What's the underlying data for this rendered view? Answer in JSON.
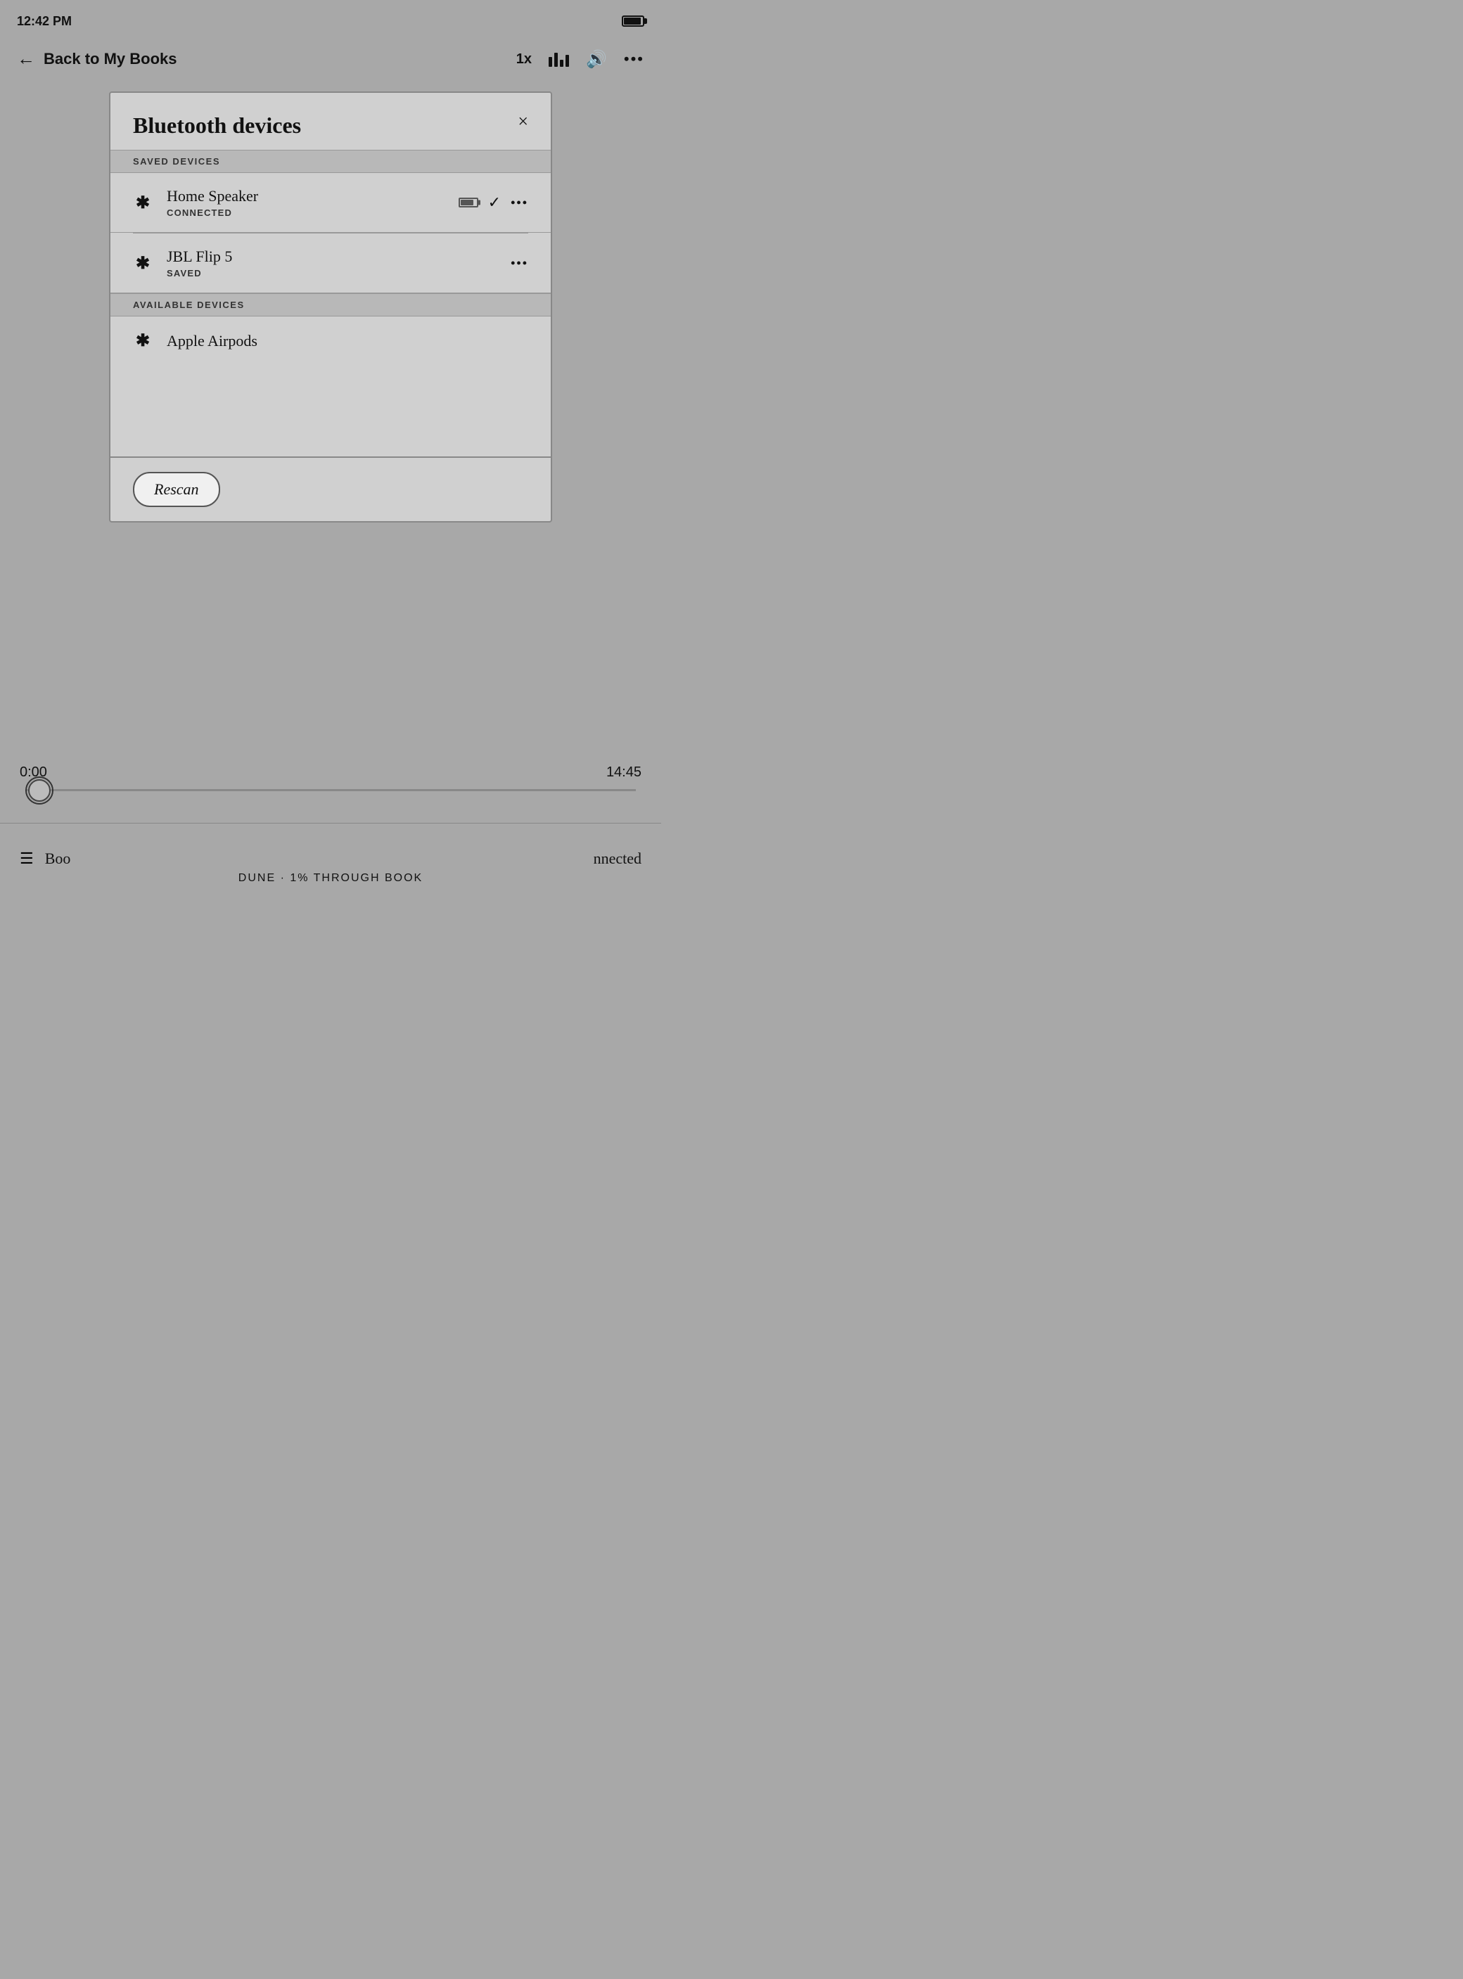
{
  "statusBar": {
    "time": "12:42 PM"
  },
  "navBar": {
    "backLabel": "Back to My Books",
    "speedLabel": "1x",
    "moreLabel": "•••"
  },
  "modal": {
    "title": "Bluetooth devices",
    "closeLabel": "×",
    "savedSection": "SAVED DEVICES",
    "availableSection": "AVAILABLE DEVICES",
    "savedDevices": [
      {
        "name": "Home Speaker",
        "status": "CONNECTED",
        "hasBattery": true,
        "hasCheck": true,
        "hasMore": true
      },
      {
        "name": "JBL Flip 5",
        "status": "SAVED",
        "hasBattery": false,
        "hasCheck": false,
        "hasMore": true
      }
    ],
    "availableDevices": [
      {
        "name": "Apple Airpods",
        "status": "",
        "hasBattery": false,
        "hasCheck": false,
        "hasMore": false
      }
    ],
    "rescanLabel": "Rescan"
  },
  "player": {
    "currentTime": "0:00",
    "totalTime": "14:45",
    "bookLabel": "Boo",
    "connectedLabel": "nnected",
    "bookInfoText": "DUNE · 1% THROUGH BOOK"
  }
}
